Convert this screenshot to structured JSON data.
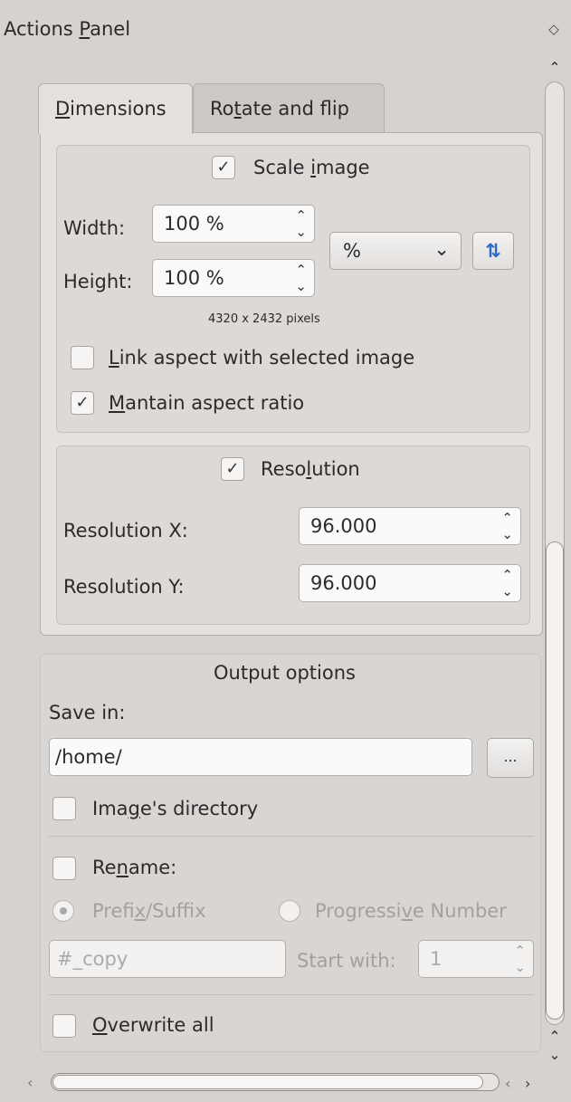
{
  "panel": {
    "title_pre": "Actions ",
    "title_mnemonic": "P",
    "title_post": "anel",
    "float_icon": "◇"
  },
  "tabs": [
    {
      "pre": "",
      "mn": "D",
      "post": "imensions"
    },
    {
      "pre": "Ro",
      "mn": "t",
      "post": "ate and flip"
    }
  ],
  "scale": {
    "checked": "✓",
    "label_pre": "Scale ",
    "label_mn": "i",
    "label_post": "mage",
    "width_label": "Width:",
    "width_value": "100 %",
    "height_label": "Height:",
    "height_value": "100 %",
    "unit": "%",
    "pixels_info": "4320 x 2432 pixels",
    "link_pre": "",
    "link_mn": "L",
    "link_post": "ink aspect with selected image",
    "maintain_checked": "✓",
    "maintain_pre": "",
    "maintain_mn": "M",
    "maintain_post": "antain aspect ratio"
  },
  "resolution": {
    "checked": "✓",
    "label_pre": "Reso",
    "label_mn": "l",
    "label_post": "ution",
    "x_label": "Resolution X:",
    "x_value": "96.000",
    "y_label": "Resolution Y:",
    "y_value": "96.000"
  },
  "output": {
    "title": "Output options",
    "save_in_label": "Save in:",
    "save_in_value": "/home/",
    "browse_label": "...",
    "image_dir_pre": "Ima",
    "image_dir_mn": "g",
    "image_dir_post": "e's directory",
    "rename_pre": "Re",
    "rename_mn": "n",
    "rename_post": "ame:",
    "prefix_pre": "Prefi",
    "prefix_mn": "x",
    "prefix_post": "/Suffix",
    "progressive_pre": "Progressi",
    "progressive_mn": "v",
    "progressive_post": "e Number",
    "pattern_value": "#_copy",
    "start_with_label": "Start with:",
    "start_with_value": "1",
    "overwrite_pre": "",
    "overwrite_mn": "O",
    "overwrite_post": "verwrite all"
  },
  "icons": {
    "spin_arrows": "⌃⌄",
    "dropdown": "⌄",
    "swap": "⇅",
    "scroll_up": "⌃",
    "scroll_down": "⌄",
    "scroll_left": "‹",
    "scroll_right": "›"
  }
}
